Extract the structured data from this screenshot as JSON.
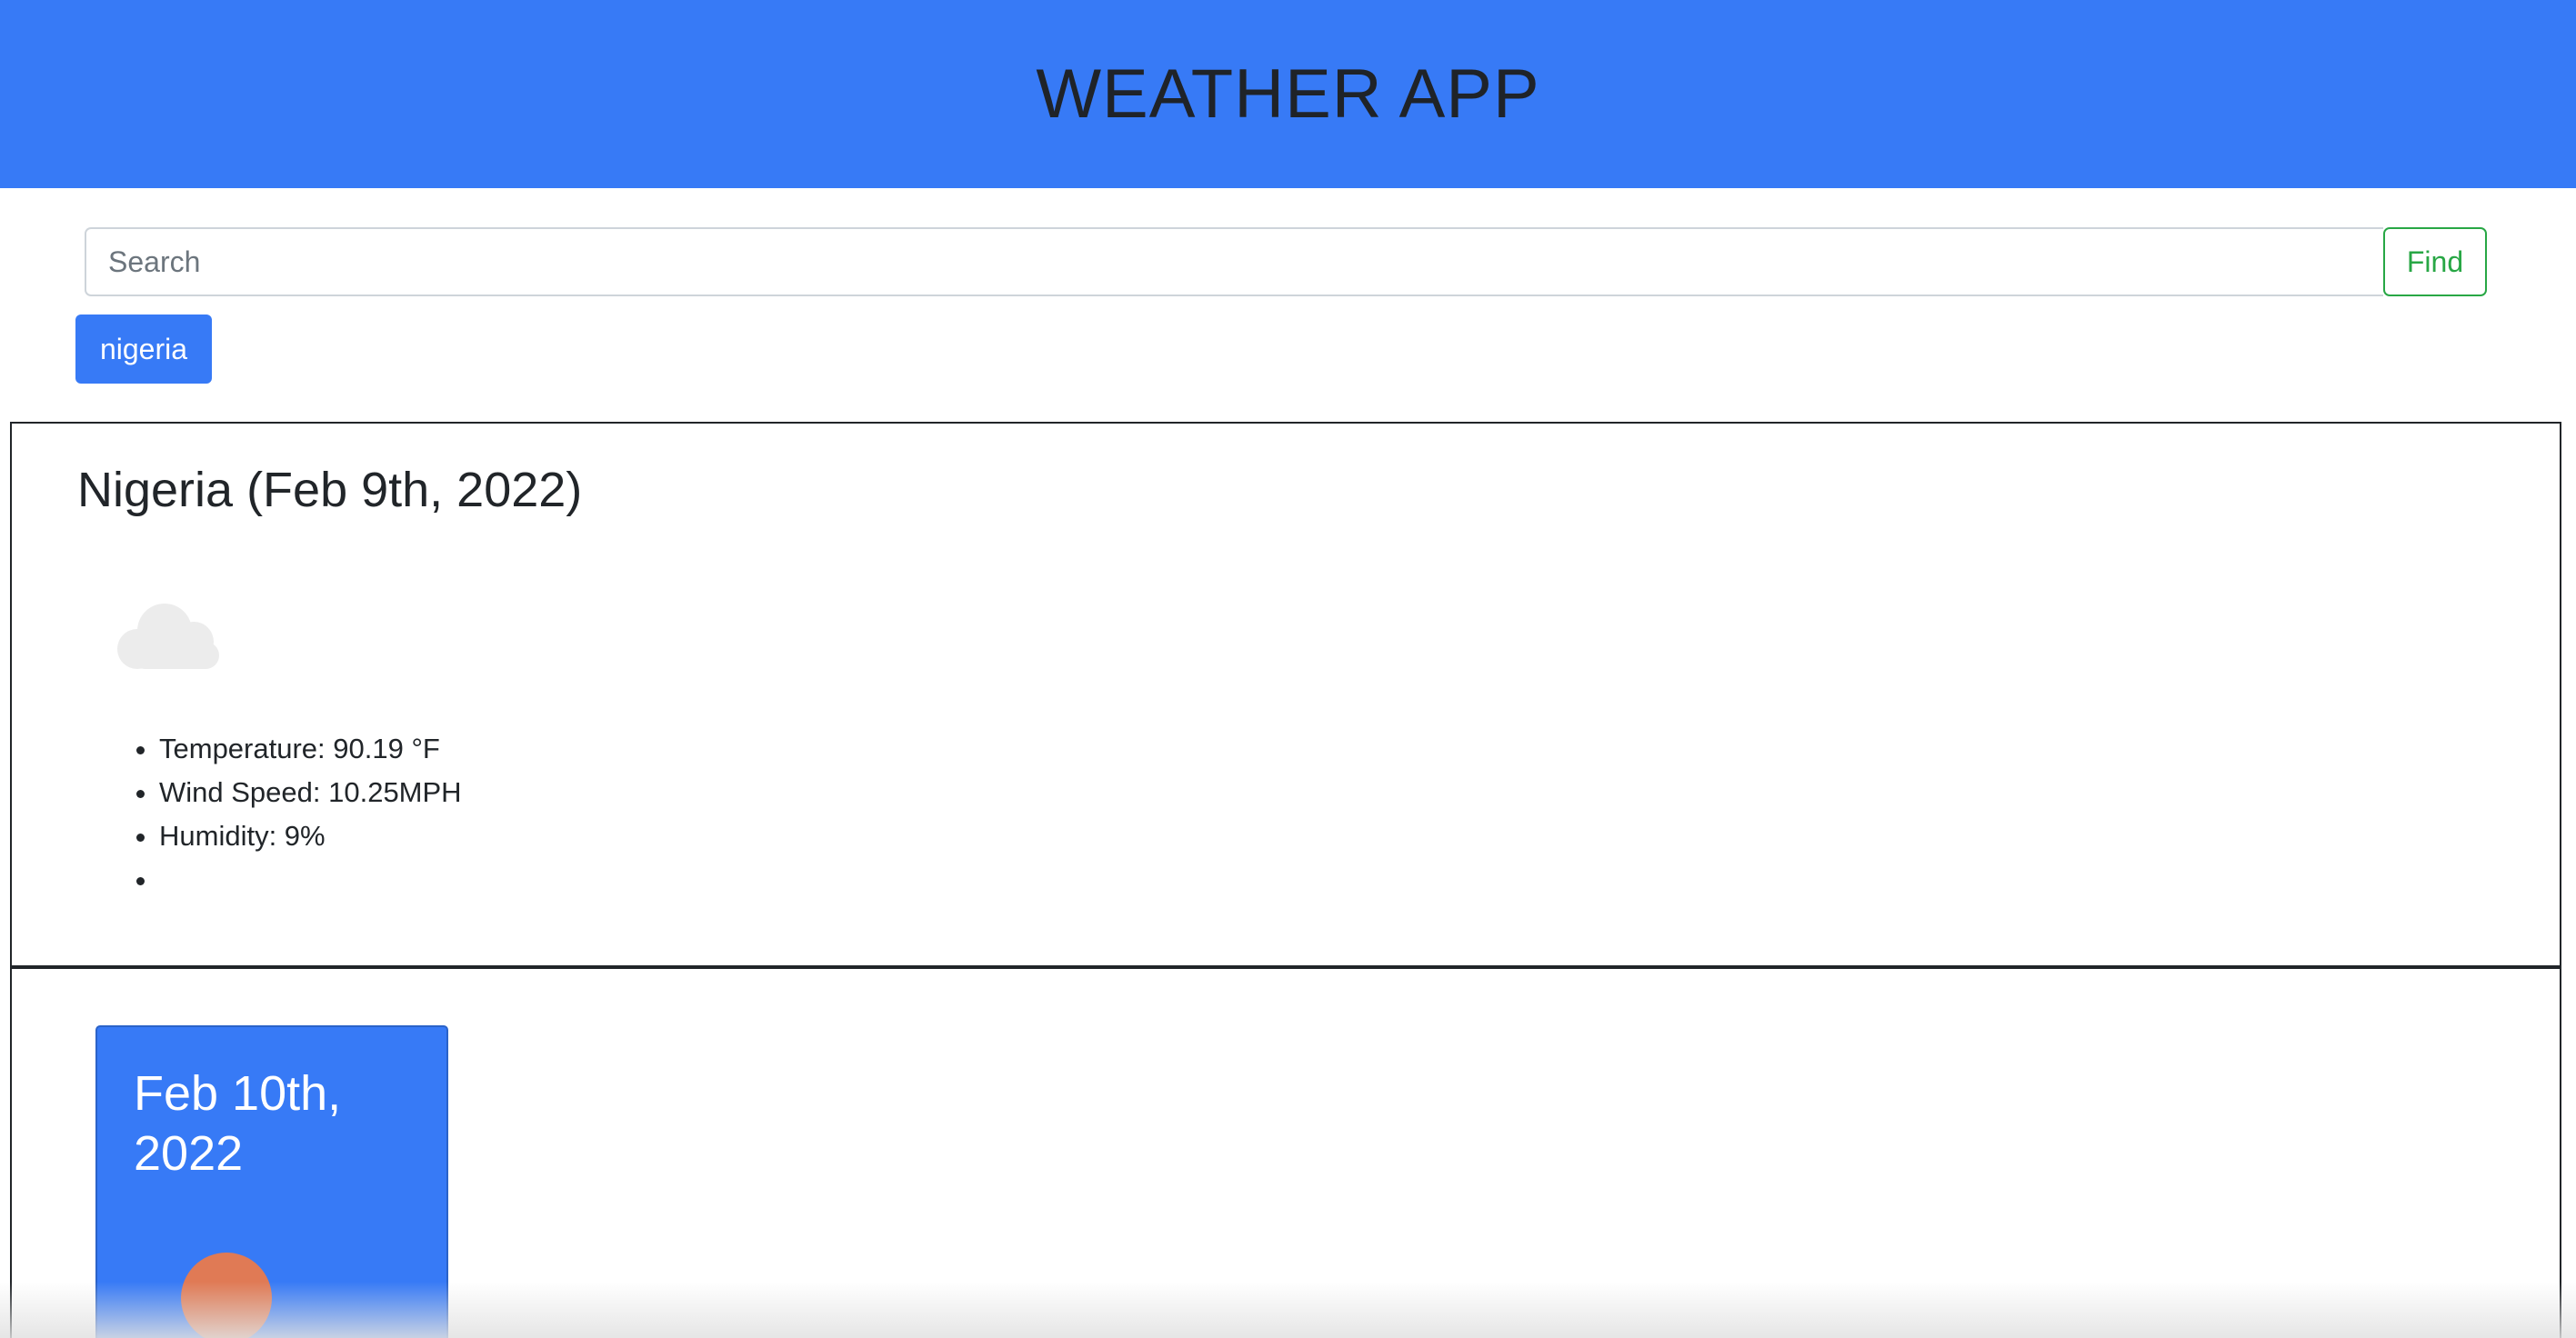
{
  "header": {
    "title": "WEATHER APP",
    "background_color": "#377af6"
  },
  "search": {
    "placeholder": "Search",
    "value": "",
    "find_label": "Find",
    "find_color": "#28a745"
  },
  "history": {
    "items": [
      {
        "label": "nigeria"
      }
    ]
  },
  "current": {
    "title": "Nigeria (Feb 9th, 2022)",
    "icon": "cloud-icon",
    "stats": [
      {
        "text": "Temperature: 90.19 °F"
      },
      {
        "text": "Wind Speed: 10.25MPH"
      },
      {
        "text": "Humidity: 9%"
      },
      {
        "text": ""
      }
    ]
  },
  "forecast": {
    "cards": [
      {
        "date": "Feb 10th, 2022",
        "icon": "sun-icon",
        "icon_color": "#e07a55",
        "card_color": "#377af6"
      }
    ]
  }
}
